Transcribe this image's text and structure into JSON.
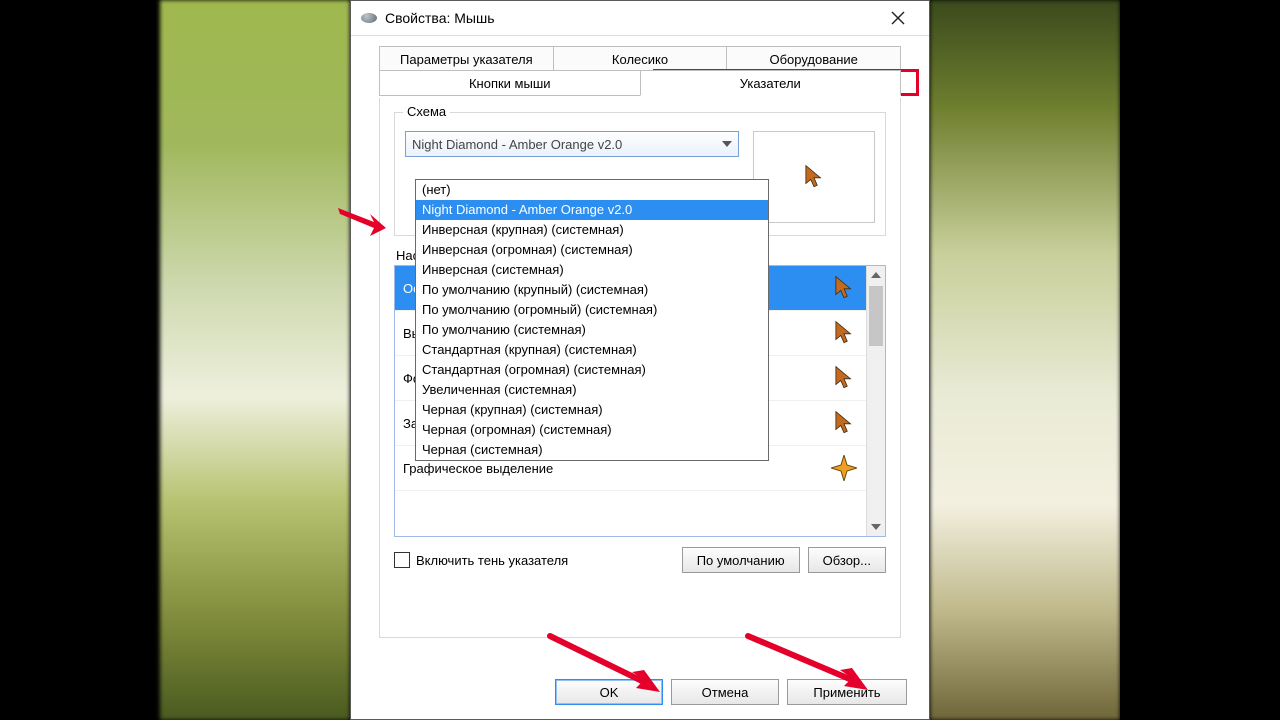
{
  "window": {
    "title": "Свойства: Мышь"
  },
  "tabs": {
    "row1": [
      "Параметры указателя",
      "Колесико",
      "Оборудование"
    ],
    "row2": [
      "Кнопки мыши",
      "Указатели"
    ],
    "active": "Указатели"
  },
  "scheme": {
    "group_label": "Схема",
    "selected": "Night Diamond - Amber Orange v2.0",
    "options": [
      "(нет)",
      "Night Diamond - Amber Orange v2.0",
      "Инверсная (крупная) (системная)",
      "Инверсная (огромная) (системная)",
      "Инверсная (системная)",
      "По умолчанию (крупный) (системная)",
      "По умолчанию (огромный) (системная)",
      "По умолчанию (системная)",
      "Стандартная (крупная) (системная)",
      "Стандартная (огромная) (системная)",
      "Увеличенная (системная)",
      "Черная (крупная) (системная)",
      "Черная (огромная) (системная)",
      "Черная (системная)"
    ],
    "highlighted_index": 1
  },
  "settings": {
    "label": "Настройка:",
    "items": [
      {
        "name": "Основной режим",
        "icon": "cursor"
      },
      {
        "name": "Выбор справки",
        "icon": "cursor"
      },
      {
        "name": "Фоновый режим",
        "icon": "cursor"
      },
      {
        "name": "Занят",
        "icon": "cursor"
      },
      {
        "name": "Графическое выделение",
        "icon": "precision"
      }
    ],
    "selected_index": 0
  },
  "checkbox": {
    "label": "Включить тень указателя",
    "checked": false
  },
  "buttons": {
    "default": "По умолчанию",
    "browse": "Обзор...",
    "ok": "OK",
    "cancel": "Отмена",
    "apply": "Применить"
  }
}
